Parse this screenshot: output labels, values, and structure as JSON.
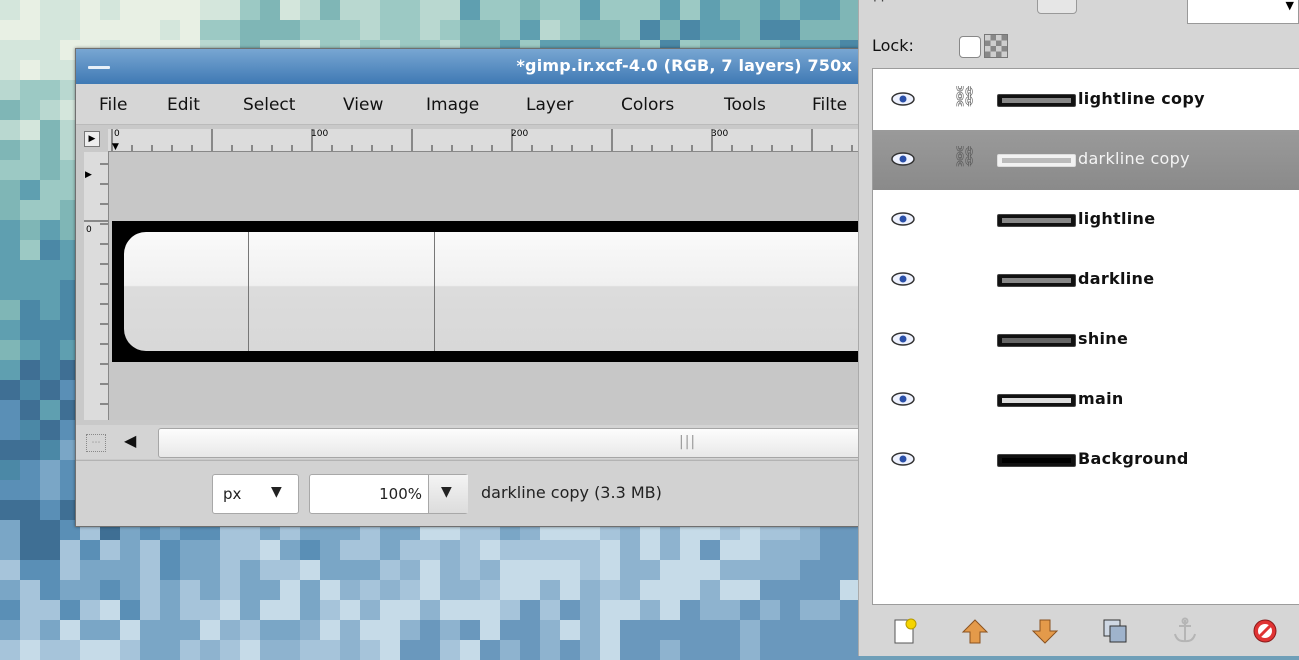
{
  "image_window": {
    "title": "*gimp.ir.xcf-4.0 (RGB, 7 layers) 750x",
    "menu": [
      "File",
      "Edit",
      "Select",
      "View",
      "Image",
      "Layer",
      "Colors",
      "Tools",
      "Filte"
    ],
    "ruler_labels": [
      "0",
      "100",
      "200",
      "300"
    ],
    "vruler_labels": [
      "0"
    ],
    "unit": "px",
    "zoom": "100%",
    "status": "darkline copy (3.3 MB)"
  },
  "layers_dock": {
    "lock_label": "Lock:",
    "layers": [
      {
        "name": "lightline copy",
        "visible": true,
        "linked": true,
        "selected": false
      },
      {
        "name": "darkline copy",
        "visible": true,
        "linked": true,
        "selected": true
      },
      {
        "name": "lightline",
        "visible": true,
        "linked": false,
        "selected": false
      },
      {
        "name": "darkline",
        "visible": true,
        "linked": false,
        "selected": false
      },
      {
        "name": "shine",
        "visible": true,
        "linked": false,
        "selected": false
      },
      {
        "name": "main",
        "visible": true,
        "linked": false,
        "selected": false
      },
      {
        "name": "Background",
        "visible": true,
        "linked": false,
        "selected": false
      }
    ],
    "buttons": [
      "new-layer-icon",
      "raise-layer-icon",
      "lower-layer-icon",
      "duplicate-layer-icon",
      "anchor-layer-icon",
      "delete-layer-icon"
    ]
  },
  "colors": {
    "titlebar": "#4f86bf",
    "selected_row": "#8f8f8f",
    "delete": "#d22a2a",
    "arrows": "#d2822f"
  }
}
